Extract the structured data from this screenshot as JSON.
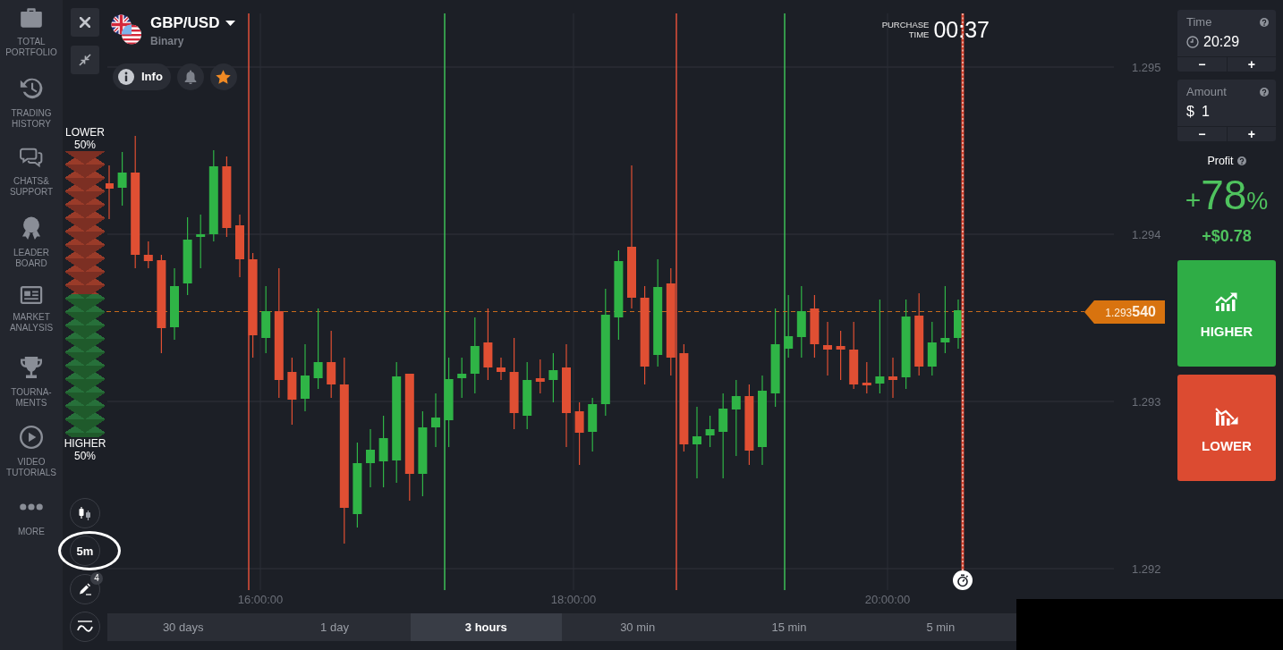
{
  "sidebar": {
    "items": [
      {
        "label": "TOTAL\nPORTFOLIO"
      },
      {
        "label": "TRADING\nHISTORY"
      },
      {
        "label": "CHATS&\nSUPPORT"
      },
      {
        "label": "LEADER\nBOARD"
      },
      {
        "label": "MARKET\nANALYSIS"
      },
      {
        "label": "TOURNA-\nMENTS"
      },
      {
        "label": "VIDEO\nTUTORIALS"
      },
      {
        "label": "MORE"
      }
    ]
  },
  "asset": {
    "name": "GBP/USD",
    "type": "Binary",
    "info_label": "Info",
    "favorite": true
  },
  "purchase_time": {
    "label": "PURCHASE\nTIME",
    "countdown": "00:37"
  },
  "sentiment": {
    "lower_label": "LOWER",
    "lower_share": "50%",
    "higher_label": "HIGHER",
    "higher_share": "50%",
    "level": 0.5
  },
  "chart": {
    "y_axis_labels": [
      "1.295",
      "1.294",
      "1.293",
      "1.292"
    ],
    "x_axis_labels": [
      "16:00:00",
      "18:00:00",
      "20:00:00"
    ],
    "price_tag": "1.293**540**"
  },
  "chart_tools": [
    {
      "kind": "chart-type"
    },
    {
      "kind": "timeframe",
      "label": "5m",
      "highlighted": true
    },
    {
      "kind": "drawing",
      "badge": "4"
    },
    {
      "kind": "indicators"
    }
  ],
  "time_ranges": [
    {
      "label": "30 days",
      "selected": false
    },
    {
      "label": "1 day",
      "selected": false
    },
    {
      "label": "3 hours",
      "selected": true
    },
    {
      "label": "30 min",
      "selected": false
    },
    {
      "label": "15 min",
      "selected": false
    },
    {
      "label": "5 min",
      "selected": false
    }
  ],
  "trade_panel": {
    "time": {
      "label": "Time",
      "value": "20:29",
      "decrease": "−",
      "increase": "+"
    },
    "amount": {
      "label": "Amount",
      "currency": "$",
      "value": "1",
      "decrease": "−",
      "increase": "+"
    },
    "profit": {
      "label": "Profit",
      "rate_sign": "+",
      "rate": "78",
      "rate_unit": "%",
      "amount": "+$0.78"
    },
    "higher_button": "HIGHER",
    "lower_button": "LOWER"
  }
}
